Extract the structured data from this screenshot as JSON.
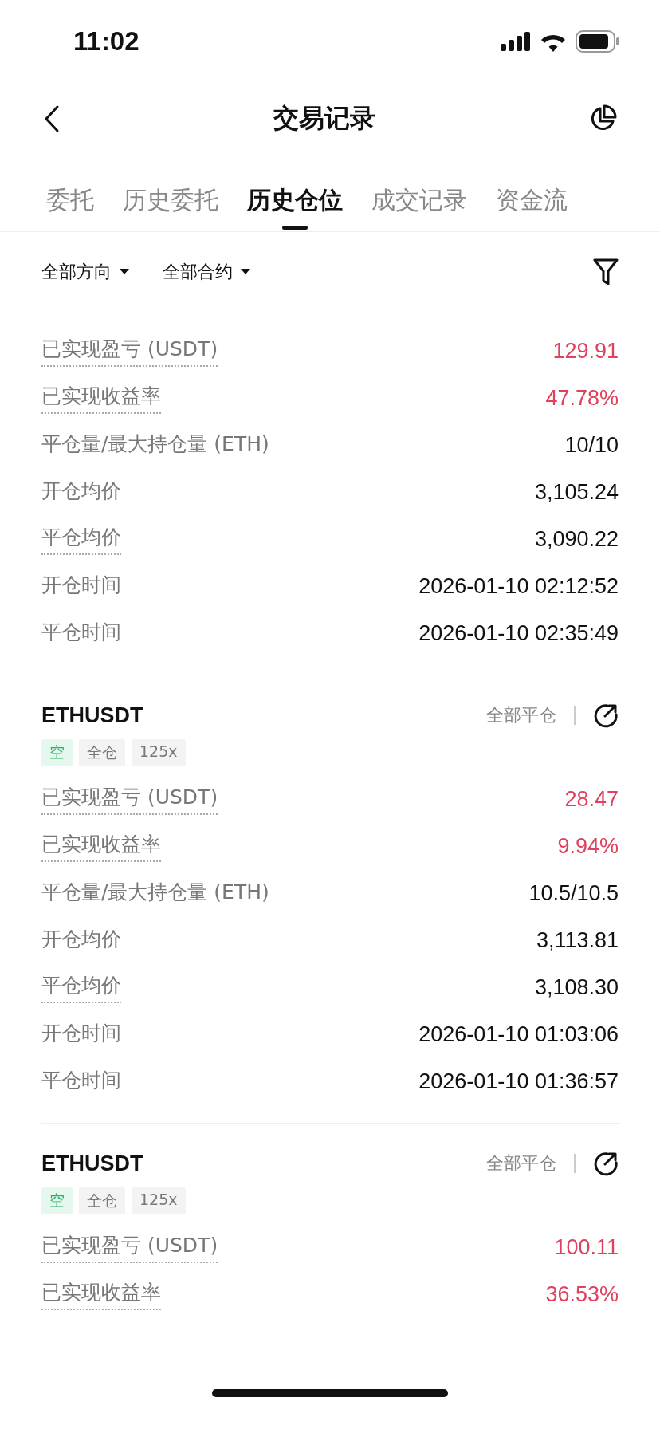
{
  "status_bar": {
    "time": "11:02"
  },
  "header": {
    "title": "交易记录"
  },
  "tabs": [
    {
      "label": "委托",
      "selected": false
    },
    {
      "label": "历史委托",
      "selected": false
    },
    {
      "label": "历史仓位",
      "selected": true
    },
    {
      "label": "成交记录",
      "selected": false
    },
    {
      "label": "资金流",
      "selected": false
    }
  ],
  "filters": [
    {
      "label": "全部方向"
    },
    {
      "label": "全部合约"
    }
  ],
  "positions": [
    {
      "rows": [
        {
          "label": "已实现盈亏 (USDT)",
          "value": "129.91",
          "dotted": true,
          "kind": "profit"
        },
        {
          "label": "已实现收益率",
          "value": "47.78%",
          "dotted": true,
          "kind": "profit"
        },
        {
          "label": "平仓量/最大持仓量 (ETH)",
          "value": "10/10",
          "dotted": false,
          "kind": "plain"
        },
        {
          "label": "开仓均价",
          "value": "3,105.24",
          "dotted": false,
          "kind": "plain"
        },
        {
          "label": "平仓均价",
          "value": "3,090.22",
          "dotted": true,
          "kind": "plain"
        },
        {
          "label": "开仓时间",
          "value": "2026-01-10 02:12:52",
          "dotted": false,
          "kind": "plain"
        },
        {
          "label": "平仓时间",
          "value": "2026-01-10 02:35:49",
          "dotted": false,
          "kind": "plain"
        }
      ]
    },
    {
      "symbol": "ETHUSDT",
      "close_type": "全部平仓",
      "tags": [
        {
          "label": "空",
          "kind": "side"
        },
        {
          "label": "全仓",
          "kind": "plain"
        },
        {
          "label": "125x",
          "kind": "plain"
        }
      ],
      "rows": [
        {
          "label": "已实现盈亏 (USDT)",
          "value": "28.47",
          "dotted": true,
          "kind": "profit"
        },
        {
          "label": "已实现收益率",
          "value": "9.94%",
          "dotted": true,
          "kind": "profit"
        },
        {
          "label": "平仓量/最大持仓量 (ETH)",
          "value": "10.5/10.5",
          "dotted": false,
          "kind": "plain"
        },
        {
          "label": "开仓均价",
          "value": "3,113.81",
          "dotted": false,
          "kind": "plain"
        },
        {
          "label": "平仓均价",
          "value": "3,108.30",
          "dotted": true,
          "kind": "plain"
        },
        {
          "label": "开仓时间",
          "value": "2026-01-10 01:03:06",
          "dotted": false,
          "kind": "plain"
        },
        {
          "label": "平仓时间",
          "value": "2026-01-10 01:36:57",
          "dotted": false,
          "kind": "plain"
        }
      ]
    },
    {
      "symbol": "ETHUSDT",
      "close_type": "全部平仓",
      "tags": [
        {
          "label": "空",
          "kind": "side"
        },
        {
          "label": "全仓",
          "kind": "plain"
        },
        {
          "label": "125x",
          "kind": "plain"
        }
      ],
      "rows": [
        {
          "label": "已实现盈亏 (USDT)",
          "value": "100.11",
          "dotted": true,
          "kind": "profit"
        },
        {
          "label": "已实现收益率",
          "value": "36.53%",
          "dotted": true,
          "kind": "profit"
        }
      ]
    }
  ]
}
